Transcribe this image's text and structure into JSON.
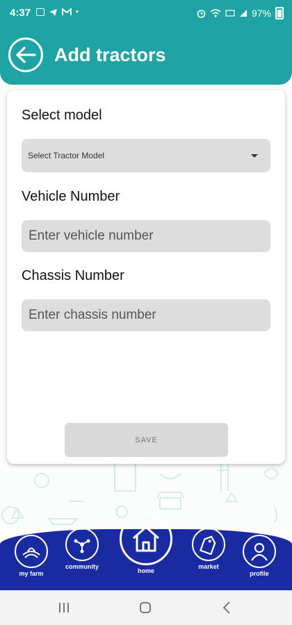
{
  "status_bar": {
    "time": "4:37",
    "battery": "97%",
    "left_icons": [
      "image-icon",
      "telegram-icon",
      "gmail-icon",
      "dot-icon"
    ],
    "right_icons": [
      "alarm-icon",
      "wifi-icon",
      "volte-icon",
      "signal-icon",
      "battery-icon"
    ]
  },
  "header": {
    "title": "Add tractors",
    "back_icon": "back-arrow-icon"
  },
  "form": {
    "model_label": "Select model",
    "model_select": {
      "value": "Select Tractor Model"
    },
    "vehicle_label": "Vehicle Number",
    "vehicle_placeholder": "Enter vehicle number",
    "chassis_label": "Chassis Number",
    "chassis_placeholder": "Enter chassis number",
    "save_label": "SAVE"
  },
  "bottom_nav": {
    "items": [
      {
        "label": "my farm",
        "icon": "farm-icon"
      },
      {
        "label": "community",
        "icon": "community-icon"
      },
      {
        "label": "home",
        "icon": "home-icon"
      },
      {
        "label": "market",
        "icon": "price-tag-icon"
      },
      {
        "label": "profile",
        "icon": "profile-icon"
      }
    ]
  },
  "colors": {
    "header": "#1fa3a3",
    "bottom_nav": "#1a2aa0",
    "input_bg": "#dddddd"
  }
}
